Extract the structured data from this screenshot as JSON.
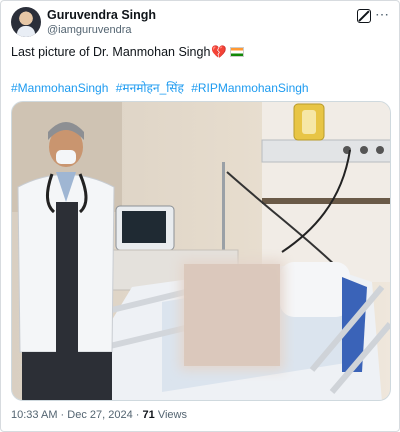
{
  "author": {
    "name": "Guruvendra Singh",
    "handle": "@iamguruvendra"
  },
  "tweet": {
    "text": "Last picture of Dr. Manmohan Singh",
    "emojis": [
      "broken-heart-icon",
      "india-flag-icon"
    ],
    "hashtags": [
      "#ManmohanSingh",
      "#मनमोहन_सिंह",
      "#RIPManmohanSingh"
    ]
  },
  "footer": {
    "time": "10:33 AM",
    "separator": "·",
    "date": "Dec 27, 2024",
    "views_count": "71",
    "views_label": "Views"
  },
  "colors": {
    "link": "#1d9bf0",
    "secondary_text": "#536471",
    "primary_text": "#0f1419"
  }
}
